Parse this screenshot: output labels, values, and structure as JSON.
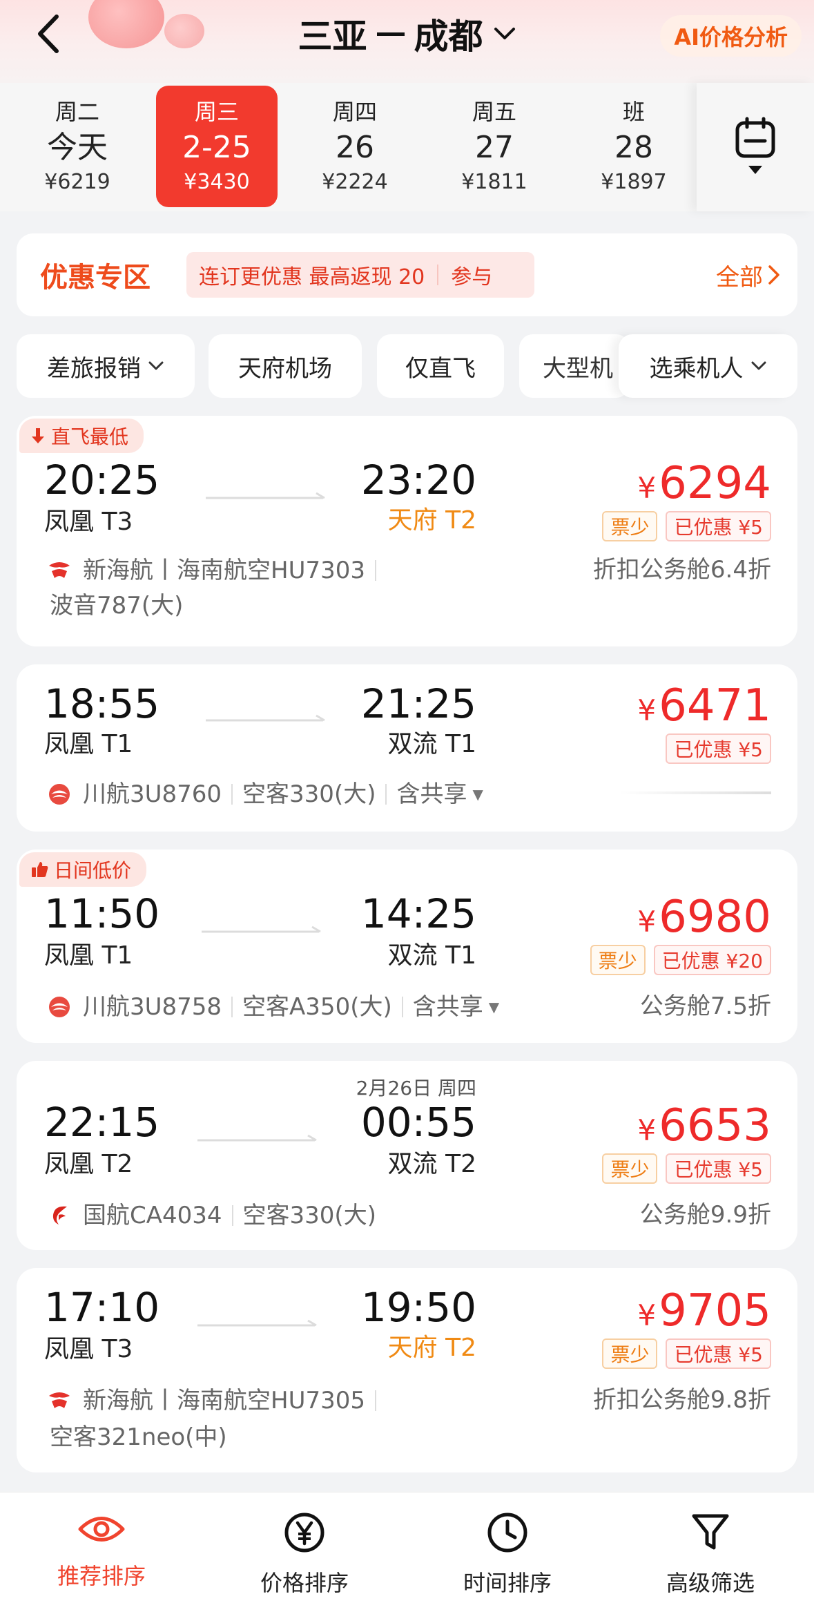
{
  "header": {
    "origin": "三亚",
    "destination": "成都",
    "ai_label": "AI价格分析"
  },
  "dates": [
    {
      "weekday": "周二",
      "day": "今天",
      "price": "¥6219",
      "active": false
    },
    {
      "weekday": "周三",
      "day": "2-25",
      "price": "¥3430",
      "active": true
    },
    {
      "weekday": "周四",
      "day": "26",
      "price": "¥2224",
      "active": false
    },
    {
      "weekday": "周五",
      "day": "27",
      "price": "¥1811",
      "active": false
    },
    {
      "weekday": "班",
      "day": "28",
      "price": "¥1897",
      "active": false
    }
  ],
  "promo": {
    "title": "优惠专区",
    "tag_text": "连订更优惠 最高返现 20",
    "tag_action": "参与",
    "all_label": "全部"
  },
  "filters": [
    {
      "label": "差旅报销",
      "has_dropdown": true
    },
    {
      "label": "天府机场",
      "has_dropdown": false
    },
    {
      "label": "仅直飞",
      "has_dropdown": false
    },
    {
      "label": "大型机",
      "has_dropdown": false
    },
    {
      "label": "选乘机人",
      "has_dropdown": true
    }
  ],
  "flights": [
    {
      "badge": "直飞最低",
      "dep_time": "20:25",
      "dep_airport": "凤凰 T3",
      "arr_time": "23:20",
      "arr_airport": "天府 T2",
      "next_day_date": "",
      "price": "6294",
      "tag_few": "票少",
      "tag_discount": "已优惠 ¥5",
      "airline": "新海航丨海南航空HU7303",
      "aircraft": "波音787(大)",
      "cabin": "折扣公务舱6.4折"
    },
    {
      "badge": "",
      "dep_time": "18:55",
      "dep_airport": "凤凰 T1",
      "arr_time": "21:25",
      "arr_airport": "双流 T1",
      "next_day_date": "",
      "price": "6471",
      "tag_few": "",
      "tag_discount": "已优惠 ¥5",
      "airline": "川航3U8760",
      "aircraft": "空客330(大)",
      "share": "含共享",
      "cabin": ""
    },
    {
      "badge": "日间低价",
      "dep_time": "11:50",
      "dep_airport": "凤凰 T1",
      "arr_time": "14:25",
      "arr_airport": "双流 T1",
      "next_day_date": "",
      "price": "6980",
      "tag_few": "票少",
      "tag_discount": "已优惠 ¥20",
      "airline": "川航3U8758",
      "aircraft": "空客A350(大)",
      "share": "含共享",
      "cabin": "公务舱7.5折"
    },
    {
      "badge": "",
      "dep_time": "22:15",
      "dep_airport": "凤凰 T2",
      "arr_time": "00:55",
      "arr_airport": "双流 T2",
      "next_day_date": "2月26日 周四",
      "price": "6653",
      "tag_few": "票少",
      "tag_discount": "已优惠 ¥5",
      "airline": "国航CA4034",
      "aircraft": "空客330(大)",
      "cabin": "公务舱9.9折"
    },
    {
      "badge": "",
      "dep_time": "17:10",
      "dep_airport": "凤凰 T3",
      "arr_time": "19:50",
      "arr_airport": "天府 T2",
      "next_day_date": "",
      "price": "9705",
      "tag_few": "票少",
      "tag_discount": "已优惠 ¥5",
      "airline": "新海航丨海南航空HU7305",
      "aircraft": "空客321neo(中)",
      "cabin": "折扣公务舱9.8折"
    }
  ],
  "currency_symbol": "¥",
  "bottom_nav": [
    {
      "label": "推荐排序",
      "icon": "eye-icon",
      "active": true
    },
    {
      "label": "价格排序",
      "icon": "yen-circle-icon",
      "active": false
    },
    {
      "label": "时间排序",
      "icon": "clock-icon",
      "active": false
    },
    {
      "label": "高级筛选",
      "icon": "filter-icon",
      "active": false
    }
  ],
  "colors": {
    "accent_red": "#f23a2e",
    "price_red": "#ee2a2a",
    "orange": "#f08a14",
    "background": "#f2f3f5"
  }
}
